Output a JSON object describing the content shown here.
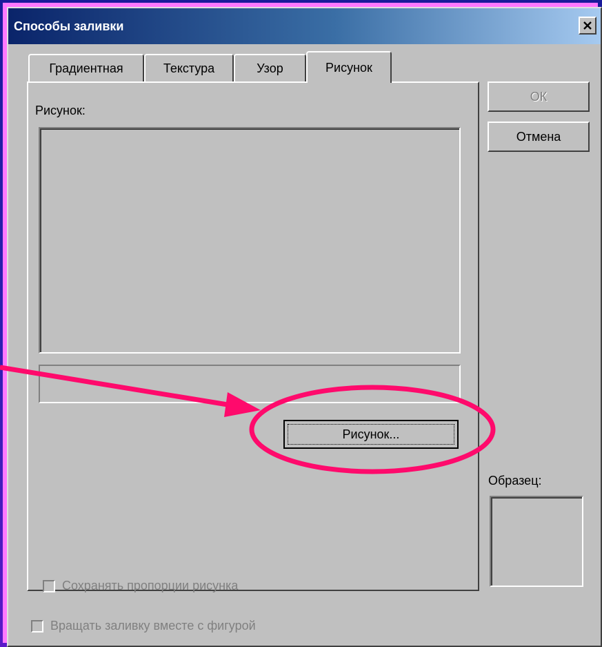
{
  "window": {
    "title": "Способы заливки"
  },
  "tabs": [
    {
      "label": "Градиентная",
      "active": false
    },
    {
      "label": "Текстура",
      "active": false
    },
    {
      "label": "Узор",
      "active": false
    },
    {
      "label": "Рисунок",
      "active": true
    }
  ],
  "panel": {
    "picture_label": "Рисунок:",
    "select_picture_button": "Рисунок...",
    "lock_aspect_checkbox": {
      "label": "Сохранять пропорции рисунка",
      "checked": false,
      "enabled": false
    }
  },
  "buttons": {
    "ok": "ОК",
    "cancel": "Отмена"
  },
  "sample": {
    "label": "Образец:"
  },
  "rotate_checkbox": {
    "label": "Вращать заливку вместе с фигурой",
    "checked": false,
    "enabled": false
  },
  "colors": {
    "annotation": "#ff0a6c",
    "face": "#c0c0c0",
    "title_start": "#0a246a",
    "title_end": "#a6caf0"
  },
  "icons": {
    "close": "close-icon",
    "arrow": "arrow-annotation"
  }
}
